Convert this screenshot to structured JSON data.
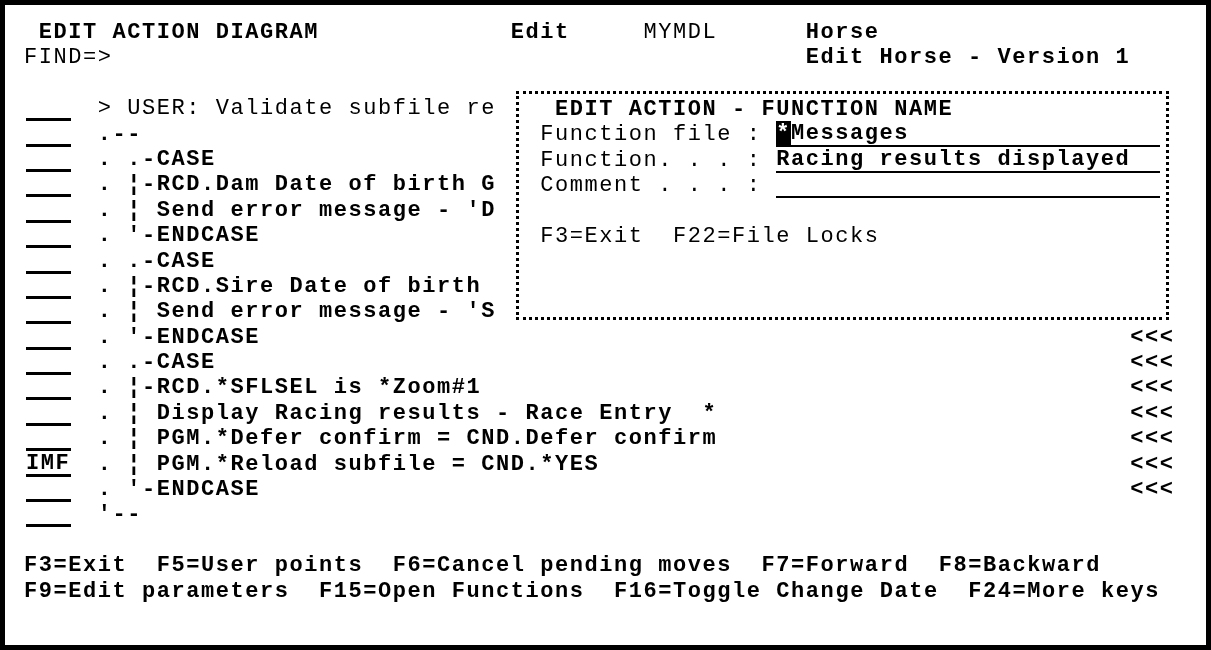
{
  "header": {
    "title": "EDIT ACTION DIAGRAM",
    "mode": "Edit",
    "model": "MYMDL",
    "file": "Horse",
    "find_label": "FIND=>",
    "subtitle": "Edit Horse - Version 1"
  },
  "diagram": {
    "lines": [
      {
        "text": "> USER: Validate subfile re",
        "bright": false
      },
      {
        "text": ".--",
        "bright": true
      },
      {
        "text": ". .-CASE",
        "bright": true
      },
      {
        "text": ". ¦-RCD.Dam Date of birth G",
        "bright": true
      },
      {
        "text": ". ¦ Send error message - 'D",
        "bright": true
      },
      {
        "text": ". '-ENDCASE",
        "bright": true
      },
      {
        "text": ". .-CASE",
        "bright": true
      },
      {
        "text": ". ¦-RCD.Sire Date of birth",
        "bright": true
      },
      {
        "text": ". ¦ Send error message - 'S",
        "bright": true
      },
      {
        "text": ". '-ENDCASE",
        "bright": true,
        "marker": "<<<"
      },
      {
        "text": ". .-CASE",
        "bright": true,
        "marker": "<<<"
      },
      {
        "text": ". ¦-RCD.*SFLSEL is *Zoom#1",
        "bright": true,
        "marker": "<<<"
      },
      {
        "text": ". ¦ Display Racing results - Race Entry  *",
        "bright": true,
        "marker": "<<<"
      },
      {
        "text": ". ¦ PGM.*Defer confirm = CND.Defer confirm",
        "bright": true,
        "marker": "<<<"
      },
      {
        "option": "IMF",
        "text": ". ¦ PGM.*Reload subfile = CND.*YES",
        "bright": true,
        "marker": "<<<"
      },
      {
        "text": ". '-ENDCASE",
        "bright": true,
        "marker": "<<<"
      },
      {
        "text": "'--",
        "bright": true
      }
    ]
  },
  "popup": {
    "title": "EDIT ACTION - FUNCTION NAME",
    "fields": [
      {
        "label": "Function file :",
        "value": "*Messages",
        "cursor": true
      },
      {
        "label": "Function. . . :",
        "value": "Racing results displayed",
        "cursor": false
      },
      {
        "label": "Comment . . . :",
        "cursor": false
      }
    ],
    "keys": [
      "F3=Exit",
      "F22=File Locks"
    ]
  },
  "function_keys": [
    {
      "keys": [
        "F3=Exit",
        "F5=User points",
        "F6=Cancel pending moves",
        "F7=Forward",
        "F8=Backward"
      ]
    },
    {
      "keys": [
        "F9=Edit parameters",
        "F15=Open Functions",
        "F16=Toggle Change Date",
        "F24=More keys"
      ]
    }
  ]
}
